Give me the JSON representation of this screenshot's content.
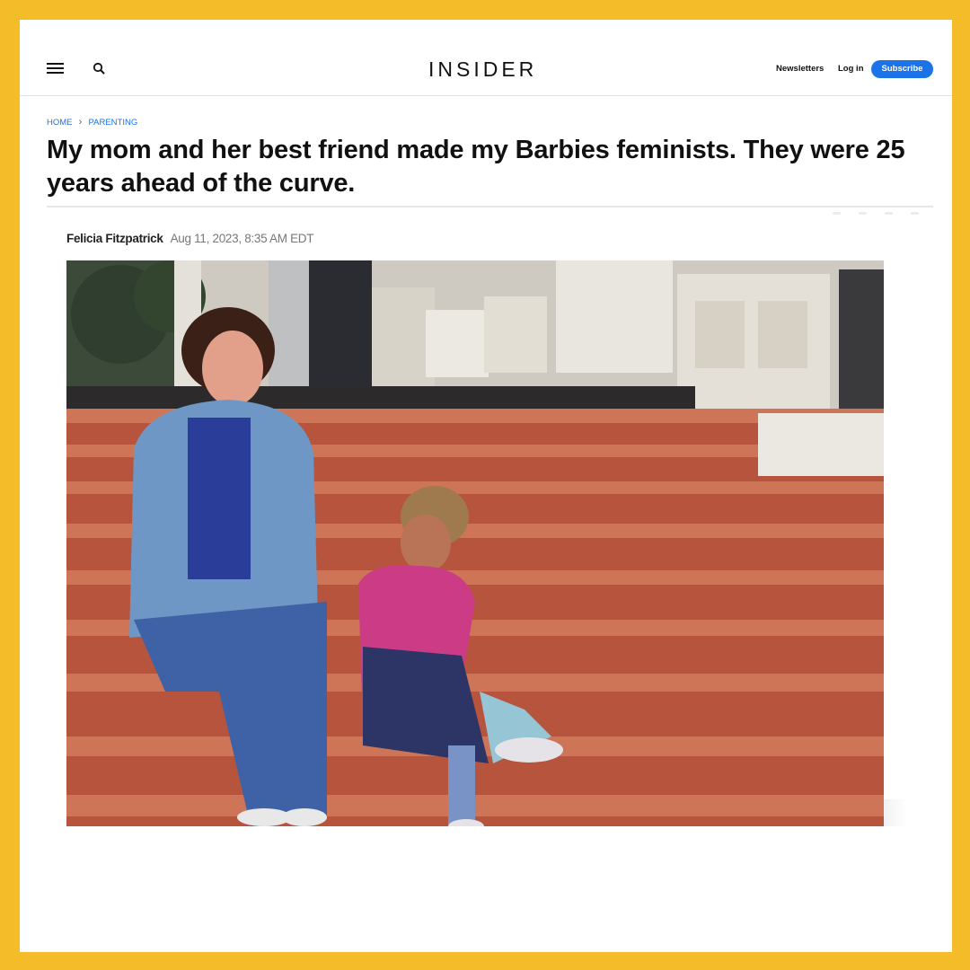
{
  "header": {
    "logo": "INSIDER",
    "newsletters": "Newsletters",
    "login": "Log in",
    "subscribe": "Subscribe"
  },
  "breadcrumb": {
    "home": "HOME",
    "section": "PARENTING"
  },
  "article": {
    "headline": "My mom and her best friend made my Barbies feminists. They were 25 years ahead of the curve.",
    "author": "Felicia Fitzpatrick",
    "date": "Aug 11, 2023, 8:35 AM EDT"
  },
  "colors": {
    "frame": "#f5bc2a",
    "accent": "#1a73e8"
  },
  "icons": [
    "menu-icon",
    "search-icon",
    "chevron-right-icon"
  ]
}
